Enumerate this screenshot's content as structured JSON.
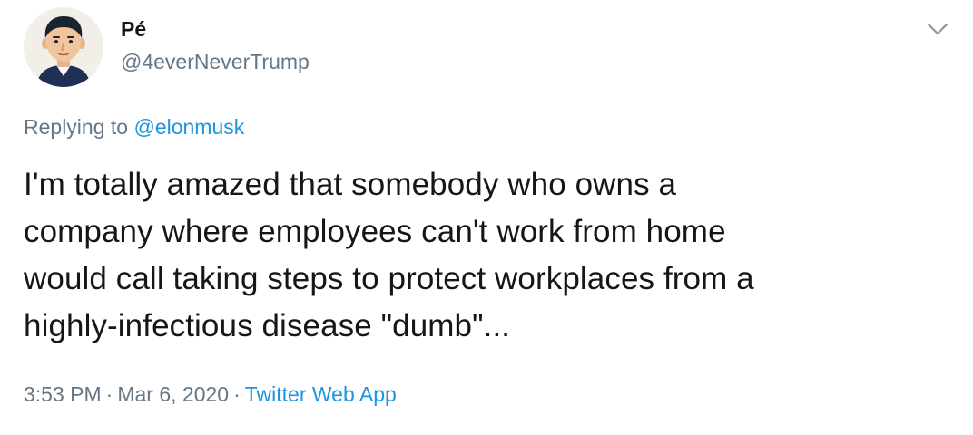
{
  "author": {
    "display_name": "Pé",
    "handle": "@4everNeverTrump",
    "avatar_icon": "cartoon-man-avatar"
  },
  "reply": {
    "prefix": "Replying to",
    "mention": "@elonmusk"
  },
  "tweet": {
    "lines": [
      "I'm totally amazed that somebody who owns a",
      "company where employees can't work from home",
      "would call taking steps to protect workplaces from a",
      "highly-infectious disease \"dumb\"..."
    ]
  },
  "meta": {
    "time": "3:53 PM",
    "separator": "·",
    "date": "Mar 6, 2020",
    "source": "Twitter Web App"
  },
  "icons": {
    "menu": "chevron-down-icon"
  },
  "colors": {
    "text": "#14171a",
    "secondary": "#657786",
    "link": "#1b95e0",
    "background": "#ffffff"
  }
}
